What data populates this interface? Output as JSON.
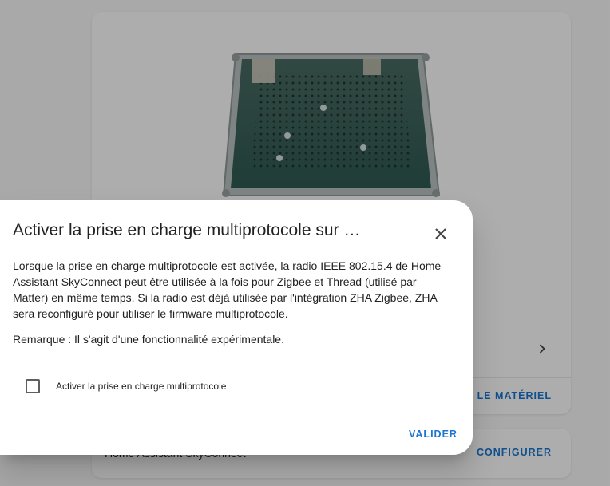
{
  "background": {
    "device_card": {
      "image_alt": "Home Assistant SkyConnect board",
      "action_label": "T LE MATÉRIEL"
    },
    "config_card": {
      "title": "Home Assistant SkyConnect",
      "button_label": "CONFIGURER"
    }
  },
  "dialog": {
    "title": "Activer la prise en charge multiprotocole sur …",
    "body": "Lorsque la prise en charge multiprotocole est activée, la radio IEEE 802.15.4 de Home Assistant SkyConnect peut être utilisée à la fois pour Zigbee et Thread (utilisé par Matter) en même temps. Si la radio est déjà utilisée par l'intégration ZHA Zigbee, ZHA sera reconfiguré pour utiliser le firmware multiprotocole.",
    "note": "Remarque : Il s'agit d'une fonctionnalité expérimentale.",
    "checkbox": {
      "label": "Activer la prise en charge multiprotocole",
      "checked": false
    },
    "submit_label": "VALIDER",
    "close_icon": "close-icon"
  },
  "colors": {
    "accent": "#1976d2",
    "scrim": "rgba(0,0,0,0.32)"
  }
}
